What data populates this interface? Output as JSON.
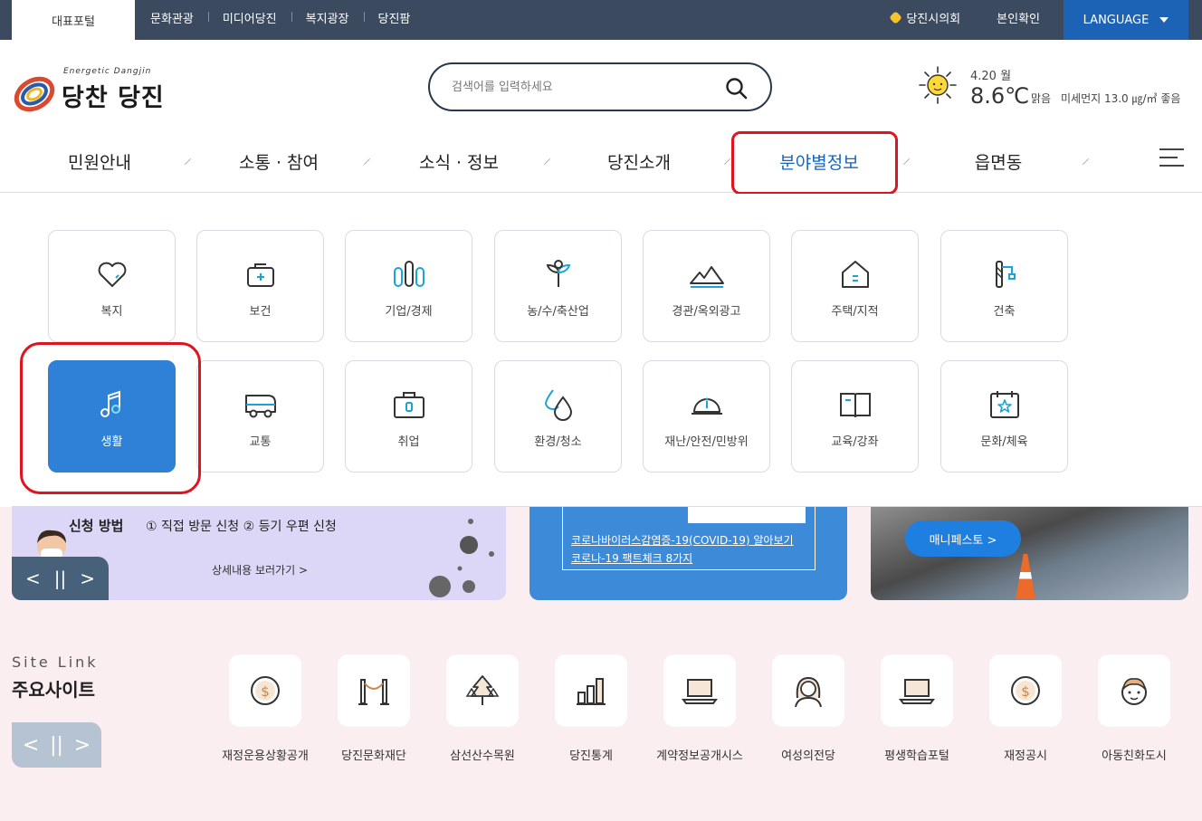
{
  "topbar": {
    "home_tab": "대표포털",
    "links": [
      "문화관광",
      "미디어당진",
      "복지광장",
      "당진팜"
    ],
    "council": "당진시의회",
    "verify": "본인확인",
    "language": "LANGUAGE"
  },
  "logo": {
    "slogan": "Energetic Dangjin",
    "name": "당찬 당진"
  },
  "search": {
    "placeholder": "검색어를 입력하세요"
  },
  "weather": {
    "date": "4.20 월",
    "temp": "8.6℃",
    "condition": "맑음",
    "dust": "미세먼지 13.0 ㎍/㎥ 좋음"
  },
  "gnb": {
    "items": [
      "민원안내",
      "소통 · 참여",
      "소식 · 정보",
      "당진소개",
      "분야별정보",
      "읍면동"
    ],
    "active_index": 4
  },
  "categories": {
    "row1": [
      "복지",
      "보건",
      "기업/경제",
      "농/수/축산업",
      "경관/옥외광고",
      "주택/지적",
      "건축"
    ],
    "row2": [
      "생활",
      "교통",
      "취업",
      "환경/청소",
      "재난/안전/민방위",
      "교육/강좌",
      "문화/체육"
    ],
    "active": "생활"
  },
  "banner1": {
    "title": "신청 방법",
    "methods": "① 직접 방문 신청   ② 등기 우편 신청",
    "more": "상세내용 보러가기  >",
    "controls": [
      "<",
      "||",
      ">"
    ]
  },
  "banner2": {
    "link1": "코로나바이러스감염증-19(COVID-19) 알아보기",
    "link2": "코로나-19 팩트체크 8가지"
  },
  "banner3": {
    "button": "매니페스토  >"
  },
  "sites": {
    "title_en": "Site Link",
    "title_ko": "주요사이트",
    "controls": [
      "<",
      "||",
      ">"
    ],
    "items": [
      {
        "label": "재정운용상황공개",
        "icon": "coin-icon"
      },
      {
        "label": "당진문화재단",
        "icon": "stanchion-icon"
      },
      {
        "label": "삼선산수목원",
        "icon": "tree-icon"
      },
      {
        "label": "당진통계",
        "icon": "bar-chart-icon"
      },
      {
        "label": "계약정보공개시스",
        "icon": "laptop-icon"
      },
      {
        "label": "여성의전당",
        "icon": "woman-icon"
      },
      {
        "label": "평생학습포털",
        "icon": "laptop-icon"
      },
      {
        "label": "재정공시",
        "icon": "coin-icon"
      },
      {
        "label": "아동친화도시",
        "icon": "child-icon"
      }
    ]
  },
  "colors": {
    "accent": "#1665c3",
    "active_card": "#2f81d8",
    "highlight": "#e0141e",
    "topbar": "#3b4a5e"
  }
}
